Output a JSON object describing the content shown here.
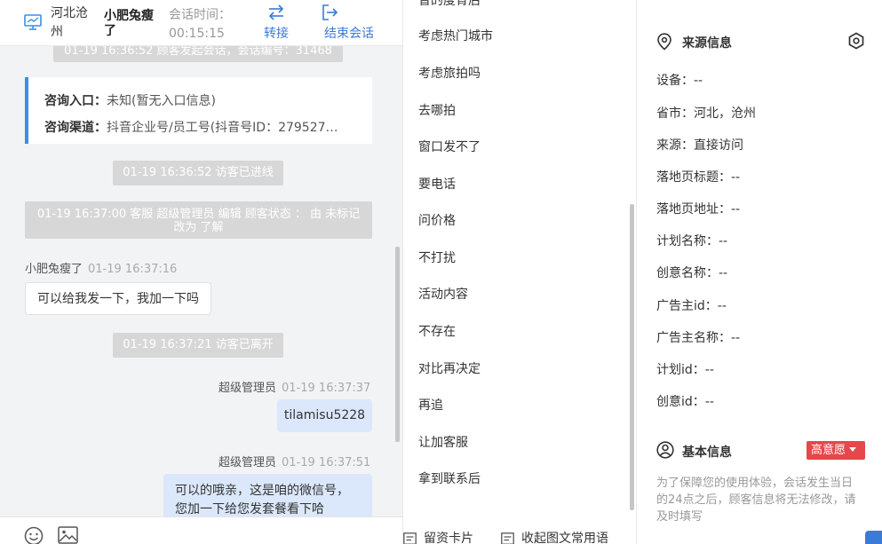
{
  "header": {
    "location": "河北沧州",
    "customer_name": "小肥兔瘦了",
    "session_time_label": "会话时间：",
    "session_time_value": "00:15:15",
    "transfer_label": "转接",
    "end_session_label": "结束会话",
    "accent_color": "#3a7bd5"
  },
  "chat": {
    "system_top": "01-19 16:36:52 顾客发起会话，会话编号：31468",
    "info_card": {
      "entry_label": "咨询入口：",
      "entry_value": "未知(暂无入口信息)",
      "channel_label": "咨询渠道：",
      "channel_value": "抖音企业号/员工号(抖音号ID：279527…"
    },
    "system_entered": "01-19 16:36:52 访客已进线",
    "system_status": "01-19 16:37:00 客服 超级管理员 编辑 顾客状态 ： 由 未标记 改为 了解",
    "msg1": {
      "sender": "小肥兔瘦了",
      "time": "01-19 16:37:16",
      "text": "可以给我发一下，我加一下吗"
    },
    "system_left": "01-19 16:37:21 访客已离开",
    "msg2": {
      "sender": "超级管理员",
      "time": "01-19 16:37:37",
      "text": "tilamisu5228"
    },
    "msg3": {
      "sender": "超级管理员",
      "time": "01-19 16:37:51",
      "text": "可以的哦亲，这是咱的微信号，您加一下给您发套餐看下哈"
    }
  },
  "footer_icons": [
    "emoji-icon",
    "image-icon"
  ],
  "quick_replies": {
    "items": [
      "考虑热门城市",
      "考虑旅拍吗",
      "去哪拍",
      "窗口发不了",
      "要电话",
      "问价格",
      "不打扰",
      "活动内容",
      "不存在",
      "对比再决定",
      "再追",
      "让加客服",
      "拿到联系后"
    ],
    "footer_card": "留资卡片",
    "footer_collect": "收起图文常用语"
  },
  "source_info": {
    "title": "来源信息",
    "rows": [
      "设备：--",
      "省市：河北，沧州",
      "来源：直接访问",
      "落地页标题：--",
      "落地页地址：--",
      "计划名称：--",
      "创意名称：--",
      "广告主id：--",
      "广告主名称：--",
      "计划id：--",
      "创意id：--"
    ]
  },
  "basic_info": {
    "title": "基本信息",
    "intent_badge": "高意愿",
    "badge_color": "#e6474a",
    "notice": "为了保障您的使用体验，会话发生当日的24点之后，顾客信息将无法修改，请及时填写"
  }
}
